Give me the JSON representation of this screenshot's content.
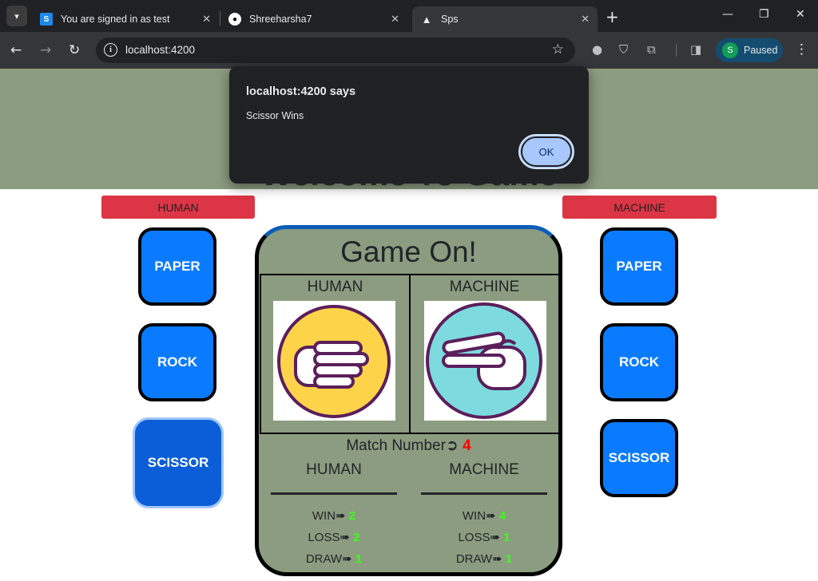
{
  "browser": {
    "tabs": [
      {
        "title": "You are signed in as test",
        "favicon": "S"
      },
      {
        "title": "Shreeharsha7"
      },
      {
        "title": "Sps"
      }
    ],
    "url": "localhost:4200",
    "profile_initial": "S",
    "profile_status": "Paused"
  },
  "page": {
    "welcome": "Welcome To Game",
    "human_label": "HUMAN",
    "machine_label": "MACHINE",
    "human_choices": [
      "PAPER",
      "ROCK",
      "SCISSOR"
    ],
    "machine_choices": [
      "PAPER",
      "ROCK",
      "SCISSOR"
    ],
    "selected_human_choice": "SCISSOR",
    "board": {
      "title": "Game On!",
      "human_title": "HUMAN",
      "machine_title": "MACHINE",
      "human_played": "rock-hand-icon",
      "machine_played": "scissor-hand-icon",
      "match_label": "Match Number➲",
      "match_number": "4",
      "human_stats_title": "HUMAN",
      "machine_stats_title": "MACHINE",
      "human_stats": {
        "win_label": "WIN➠",
        "win": "2",
        "loss_label": "LOSS➠",
        "loss": "2",
        "draw_label": "DRAW➠",
        "draw": "1"
      },
      "machine_stats": {
        "win_label": "WIN➠",
        "win": "4",
        "loss_label": "LOSS➠",
        "loss": "1",
        "draw_label": "DRAW➠",
        "draw": "1"
      }
    }
  },
  "dialog": {
    "title": "localhost:4200 says",
    "message": "Scissor Wins",
    "ok_label": "OK"
  },
  "colors": {
    "banner": "#8c9c80",
    "choice_button": "#0a7bff",
    "label_bar": "#dc3545",
    "stat_value": "#39ff14",
    "match_number": "#ff0000"
  }
}
